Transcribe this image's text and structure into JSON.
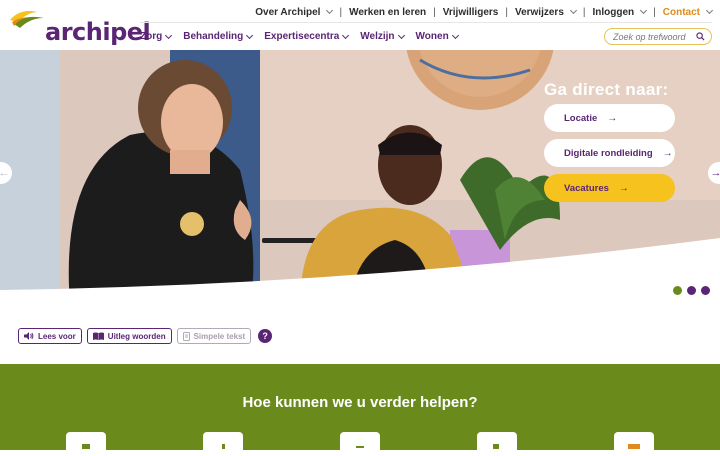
{
  "brand": {
    "name": "archipel",
    "accent": "#5a2574",
    "green": "#6b8a1c",
    "yellow": "#f5c21e",
    "orange": "#e08a1e"
  },
  "top_nav": {
    "about": "Over Archipel",
    "work": "Werken en leren",
    "volunteers": "Vrijwilligers",
    "referrers": "Verwijzers",
    "login": "Inloggen",
    "contact": "Contact"
  },
  "main_nav": {
    "care": "Zorg",
    "treatment": "Behandeling",
    "expertise": "Expertisecentra",
    "wellbeing": "Welzijn",
    "housing": "Wonen"
  },
  "search": {
    "placeholder": "Zoek op trefwoord",
    "icon": "search-icon"
  },
  "hero": {
    "goto_title": "Ga direct naar:",
    "buttons": {
      "location": "Locatie",
      "tour": "Digitale rondleiding",
      "vacancies": "Vacatures"
    },
    "arrow": "→",
    "prev_icon": "chevron-left-icon",
    "next_icon": "chevron-right-icon",
    "active_slide": 1,
    "slide_count": 3
  },
  "tools": {
    "read_aloud": "Lees voor",
    "explain_words": "Uitleg woorden",
    "simple_text": "Simpele tekst",
    "help": "?"
  },
  "help_section": {
    "title": "Hoe kunnen we u verder helpen?"
  }
}
